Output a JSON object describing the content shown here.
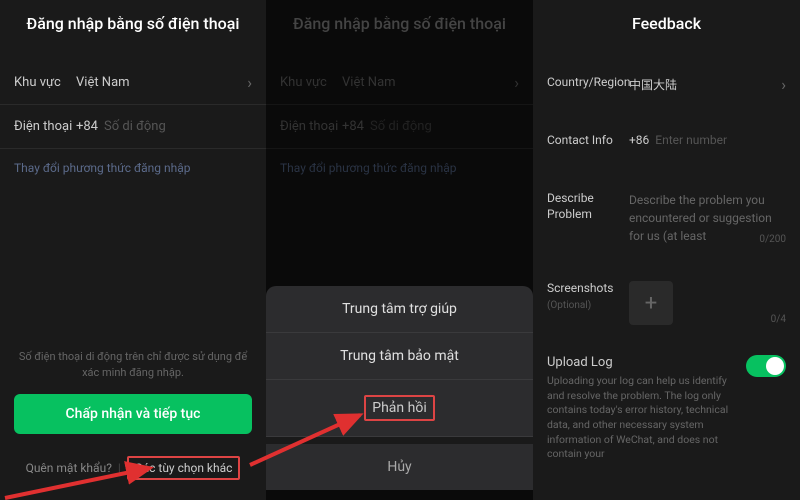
{
  "col1": {
    "header": "Đăng nhập bằng số điện thoại",
    "region_label": "Khu vực",
    "region_value": "Việt Nam",
    "phone_label": "Điện thoại",
    "phone_prefix": "+84",
    "phone_placeholder": "Số di động",
    "change_method": "Thay đổi phương thức đăng nhập",
    "hint": "Số điện thoại di động trên chỉ được sử dụng để xác minh đăng nhập.",
    "accept_btn": "Chấp nhận và tiếp tục",
    "forgot": "Quên mật khẩu?",
    "other_options": "Các tùy chọn khác"
  },
  "col2": {
    "header": "Đăng nhập bằng số điện thoại",
    "region_label": "Khu vực",
    "region_value": "Việt Nam",
    "phone_label": "Điện thoại",
    "phone_prefix": "+84",
    "phone_placeholder": "Số di động",
    "change_method": "Thay đổi phương thức đăng nhập",
    "sheet": {
      "help_center": "Trung tâm trợ giúp",
      "security_center": "Trung tâm bảo mật",
      "feedback": "Phản hồi",
      "cancel": "Hủy"
    }
  },
  "col3": {
    "header": "Feedback",
    "region_label": "Country/Region",
    "region_value": "中国大陆",
    "contact_label": "Contact Info",
    "contact_prefix": "+86",
    "contact_placeholder": "Enter number",
    "describe_label": "Describe Problem",
    "describe_placeholder": "Describe the problem you encountered or suggestion for us (at least",
    "char_count": "0/200",
    "screenshots_label": "Screenshots",
    "optional": "(Optional)",
    "ss_count": "0/4",
    "upload_label": "Upload Log",
    "upload_desc": "Uploading your log can help us identify and resolve the problem. The log only contains today's error history, technical data, and other necessary system information of WeChat, and does not contain your"
  }
}
